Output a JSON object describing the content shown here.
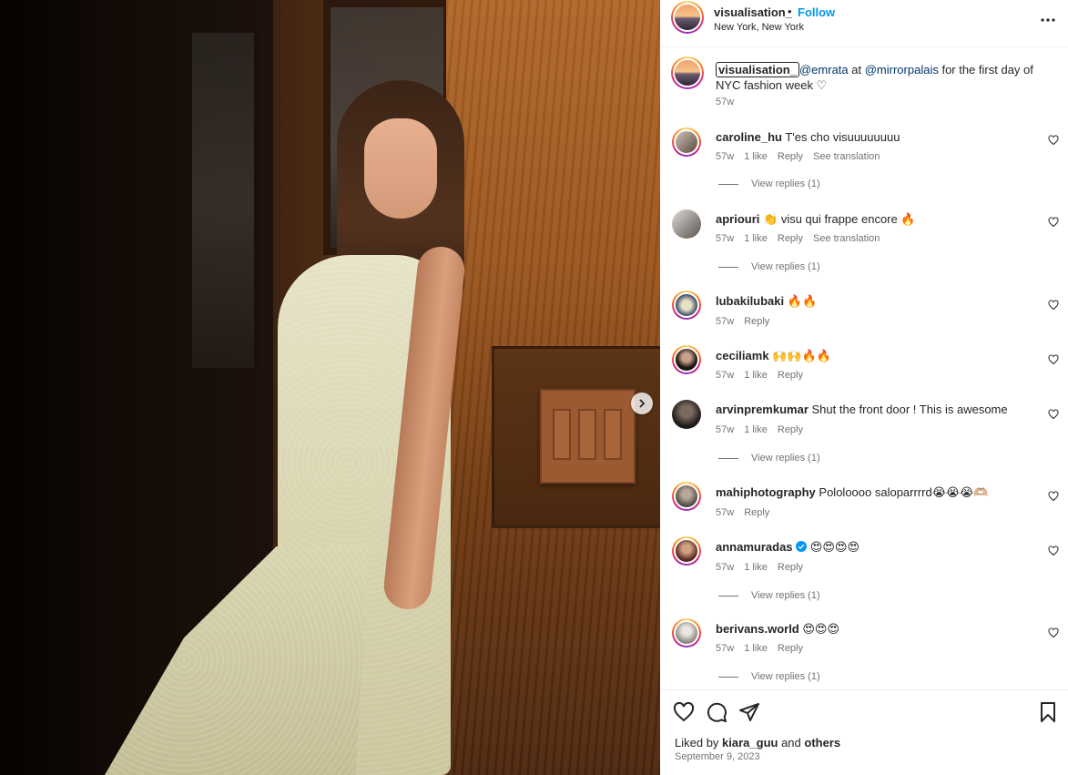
{
  "post": {
    "username": "visualisation_",
    "dot": "•",
    "follow": "Follow",
    "location": "New York, New York"
  },
  "caption": {
    "username": "visualisation_",
    "mention1": "@emrata",
    "text1": " at ",
    "mention2": "@mirrorpalais",
    "text2": " for the first day of NYC fashion week ♡",
    "time": "57w"
  },
  "comments": [
    {
      "user": "caroline_hu",
      "text": "T'es cho visuuuuuuuu",
      "time": "57w",
      "likes": "1 like",
      "reply": "Reply",
      "translate": "See translation",
      "replies": "View replies (1)"
    },
    {
      "user": "apriouri",
      "text": "👏 visu qui frappe encore 🔥",
      "time": "57w",
      "likes": "1 like",
      "reply": "Reply",
      "translate": "See translation",
      "replies": "View replies (1)"
    },
    {
      "user": "lubakilubaki",
      "text": "🔥🔥",
      "time": "57w",
      "reply": "Reply"
    },
    {
      "user": "ceciliamk",
      "text": "🙌🙌🔥🔥",
      "time": "57w",
      "likes": "1 like",
      "reply": "Reply"
    },
    {
      "user": "arvinpremkumar",
      "text": "Shut the front door ! This is awesome",
      "time": "57w",
      "likes": "1 like",
      "reply": "Reply",
      "replies": "View replies (1)"
    },
    {
      "user": "mahiphotography",
      "text": "Pololoooo saloparrrrd😭😭😭🫶🏼",
      "time": "57w",
      "reply": "Reply"
    },
    {
      "user": "annamuradas",
      "text": "😍😍😍😍",
      "time": "57w",
      "likes": "1 like",
      "reply": "Reply",
      "replies": "View replies (1)"
    },
    {
      "user": "berivans.world",
      "text": "😍😍😍",
      "time": "57w",
      "likes": "1 like",
      "reply": "Reply",
      "replies": "View replies (1)"
    }
  ],
  "footer": {
    "liked_prefix": "Liked by ",
    "liked_user": "kiara_guu",
    "liked_mid": " and ",
    "liked_others": "others",
    "date": "September 9, 2023"
  },
  "colors": {
    "accent": "#0095f6",
    "mention": "#00376b",
    "muted": "#737373",
    "verified": "#0095f6"
  }
}
